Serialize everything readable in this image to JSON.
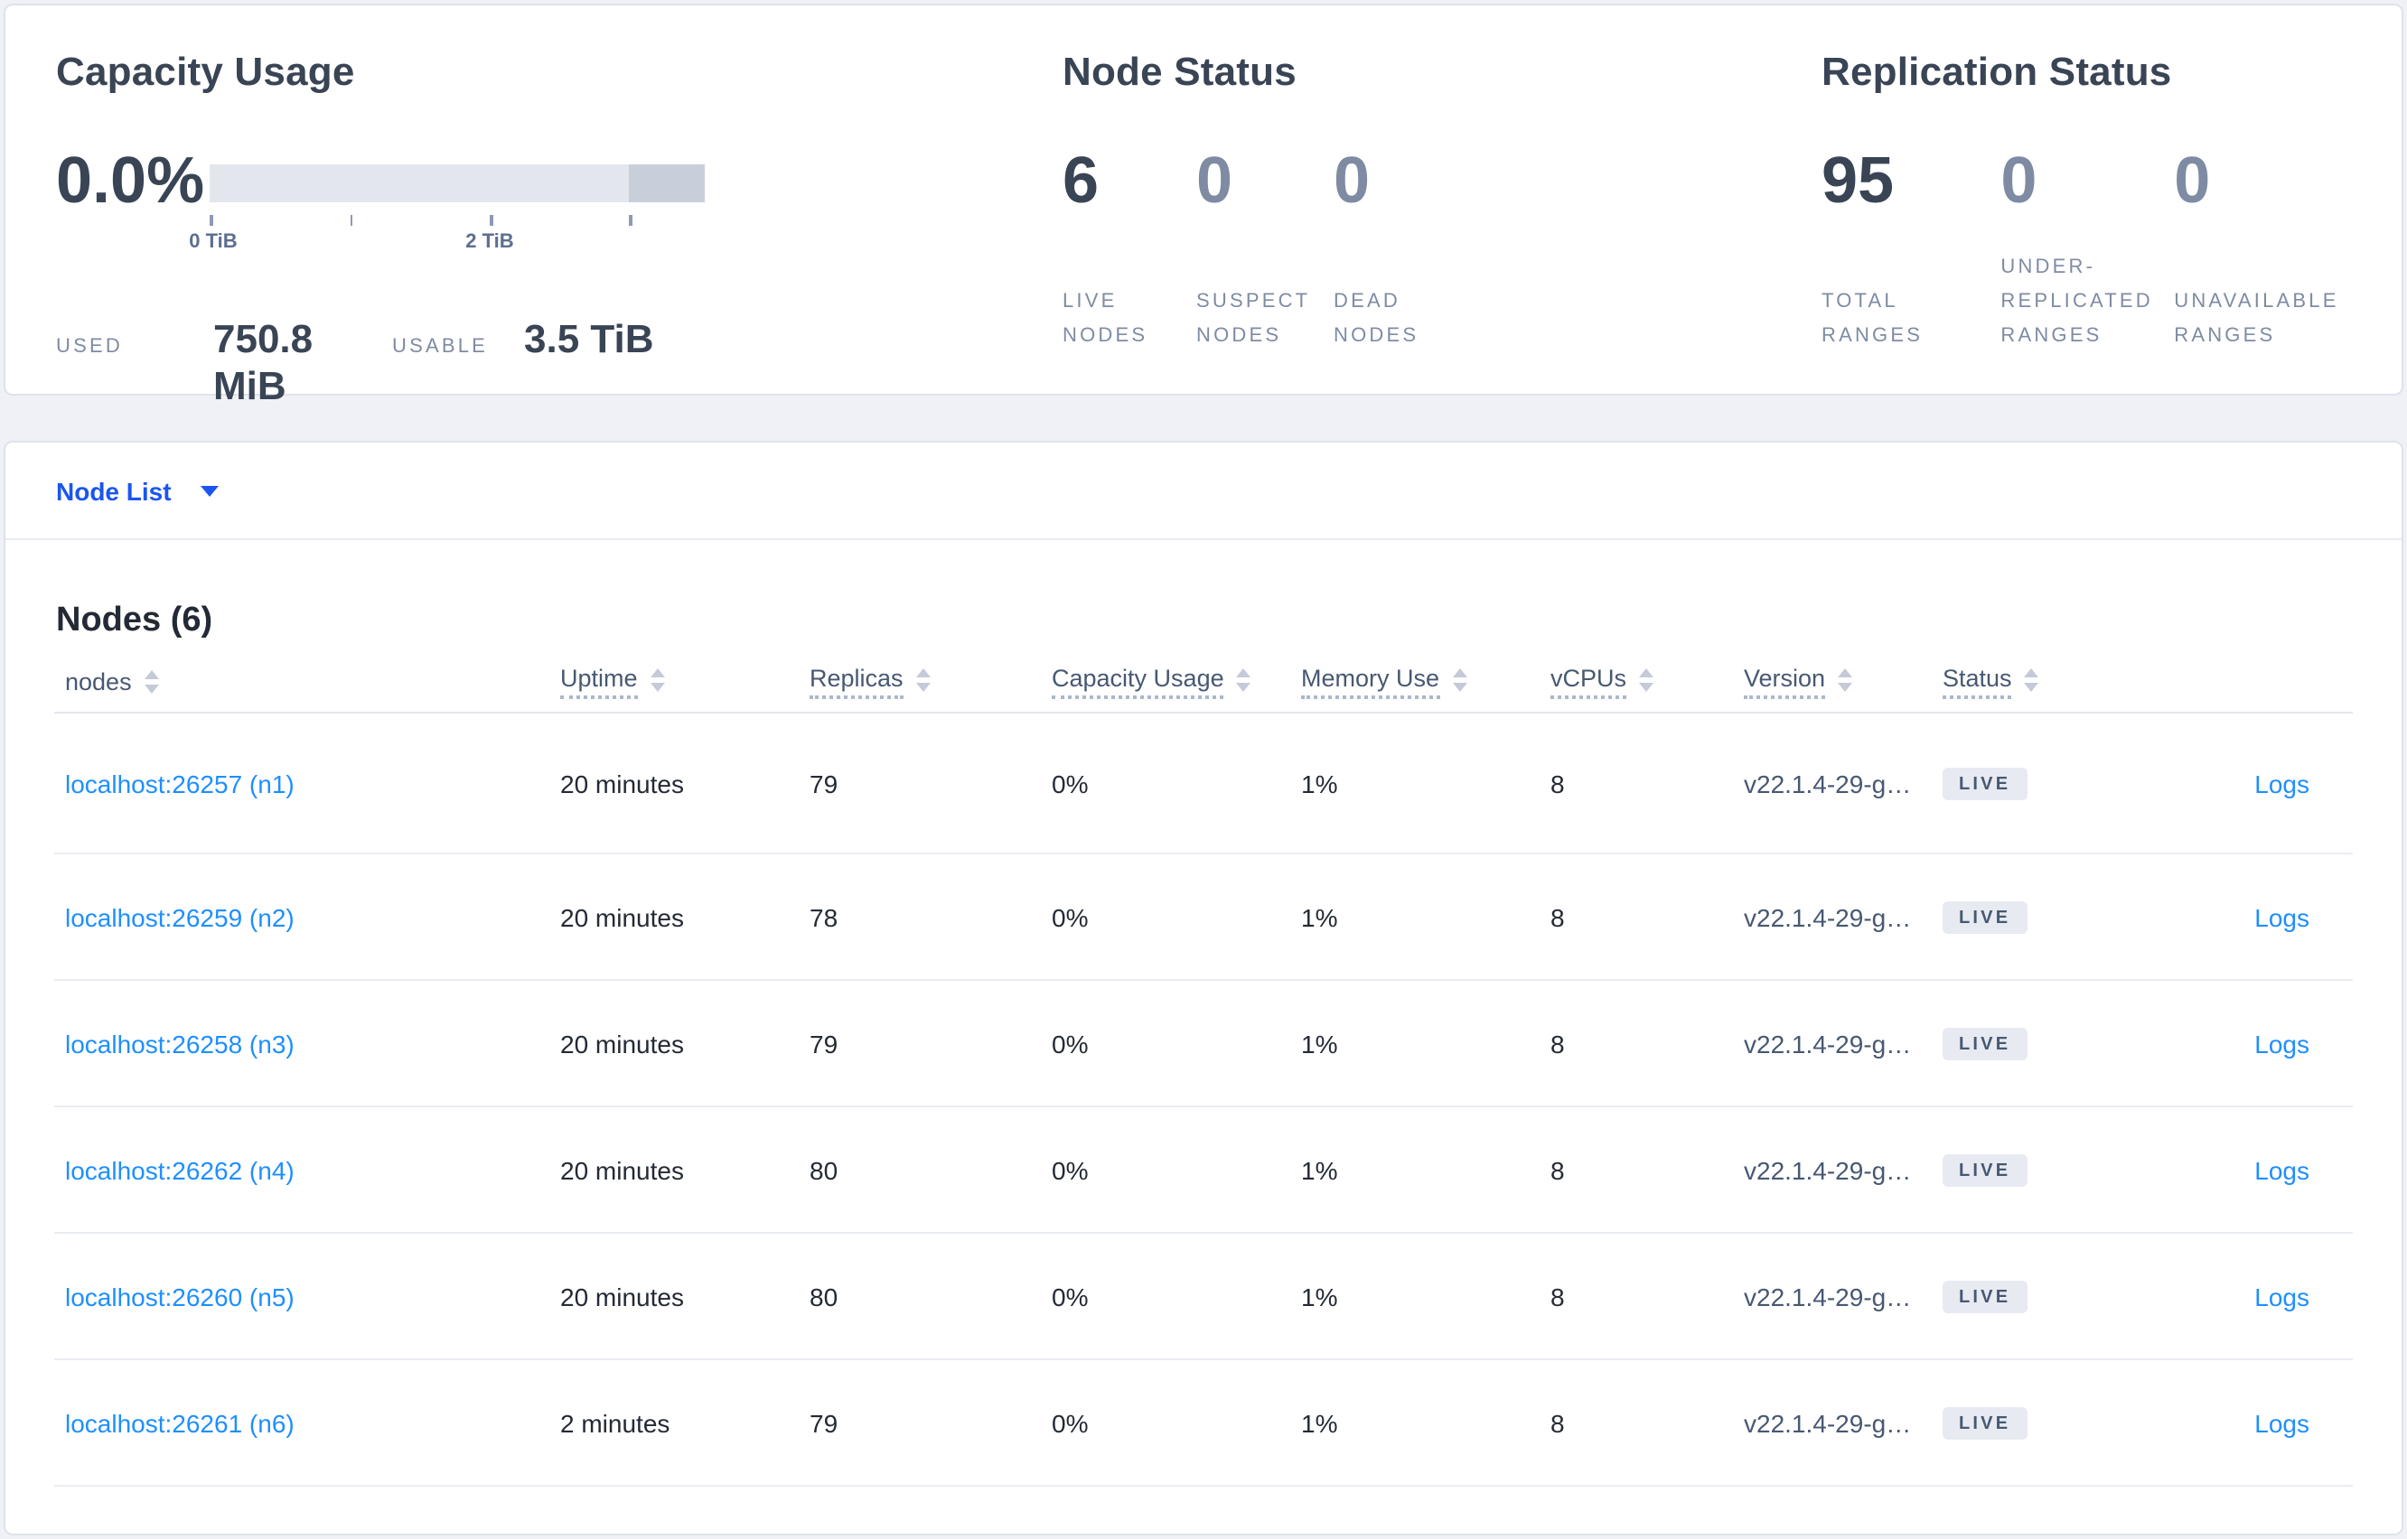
{
  "summary": {
    "capacity": {
      "title": "Capacity Usage",
      "percent": "0.0%",
      "tick_labels": [
        "0 TiB",
        "2 TiB"
      ],
      "used_label": "USED",
      "used_value": "750.8 MiB",
      "usable_label": "USABLE",
      "usable_value": "3.5 TiB"
    },
    "node_status": {
      "title": "Node Status",
      "stats": [
        {
          "value": "6",
          "label": "LIVE NODES",
          "emphasis": true
        },
        {
          "value": "0",
          "label": "SUSPECT NODES",
          "emphasis": false
        },
        {
          "value": "0",
          "label": "DEAD NODES",
          "emphasis": false
        }
      ]
    },
    "replication": {
      "title": "Replication Status",
      "stats": [
        {
          "value": "95",
          "label": "TOTAL RANGES",
          "emphasis": true
        },
        {
          "value": "0",
          "label": "UNDER-REPLICATED RANGES",
          "emphasis": false
        },
        {
          "value": "0",
          "label": "UNAVAILABLE RANGES",
          "emphasis": false
        }
      ]
    }
  },
  "view_selector": {
    "label": "Node List",
    "icon": "chevron-down-icon"
  },
  "table": {
    "title": "Nodes (6)",
    "columns": [
      {
        "label": "nodes",
        "sortable": true,
        "tooltip": false
      },
      {
        "label": "Uptime",
        "sortable": true,
        "tooltip": true
      },
      {
        "label": "Replicas",
        "sortable": true,
        "tooltip": true
      },
      {
        "label": "Capacity Usage",
        "sortable": true,
        "tooltip": true
      },
      {
        "label": "Memory Use",
        "sortable": true,
        "tooltip": true
      },
      {
        "label": "vCPUs",
        "sortable": true,
        "tooltip": true
      },
      {
        "label": "Version",
        "sortable": true,
        "tooltip": true
      },
      {
        "label": "Status",
        "sortable": true,
        "tooltip": true
      },
      {
        "label": "",
        "sortable": false,
        "tooltip": false
      }
    ],
    "rows": [
      {
        "node": "localhost:26257 (n1)",
        "uptime": "20 minutes",
        "replicas": "79",
        "capacity": "0%",
        "memory": "1%",
        "vcpus": "8",
        "version": "v22.1.4-29-g…",
        "status": "LIVE",
        "logs": "Logs"
      },
      {
        "node": "localhost:26259 (n2)",
        "uptime": "20 minutes",
        "replicas": "78",
        "capacity": "0%",
        "memory": "1%",
        "vcpus": "8",
        "version": "v22.1.4-29-g…",
        "status": "LIVE",
        "logs": "Logs"
      },
      {
        "node": "localhost:26258 (n3)",
        "uptime": "20 minutes",
        "replicas": "79",
        "capacity": "0%",
        "memory": "1%",
        "vcpus": "8",
        "version": "v22.1.4-29-g…",
        "status": "LIVE",
        "logs": "Logs"
      },
      {
        "node": "localhost:26262 (n4)",
        "uptime": "20 minutes",
        "replicas": "80",
        "capacity": "0%",
        "memory": "1%",
        "vcpus": "8",
        "version": "v22.1.4-29-g…",
        "status": "LIVE",
        "logs": "Logs"
      },
      {
        "node": "localhost:26260 (n5)",
        "uptime": "20 minutes",
        "replicas": "80",
        "capacity": "0%",
        "memory": "1%",
        "vcpus": "8",
        "version": "v22.1.4-29-g…",
        "status": "LIVE",
        "logs": "Logs"
      },
      {
        "node": "localhost:26261 (n6)",
        "uptime": "2 minutes",
        "replicas": "79",
        "capacity": "0%",
        "memory": "1%",
        "vcpus": "8",
        "version": "v22.1.4-29-g…",
        "status": "LIVE",
        "logs": "Logs"
      }
    ]
  },
  "colors": {
    "page_background": "#eff1f6",
    "card_border": "#dde3ea",
    "heading": "#394455",
    "muted_label": "#7e8ba3",
    "primary_link": "#1b55f0",
    "table_link": "#1e8fff",
    "table_text": "#242a35",
    "header_text": "#475872",
    "badge_background": "#e7eaf1",
    "bar_light": "#e3e6ed",
    "bar_dark": "#c9cfda"
  }
}
